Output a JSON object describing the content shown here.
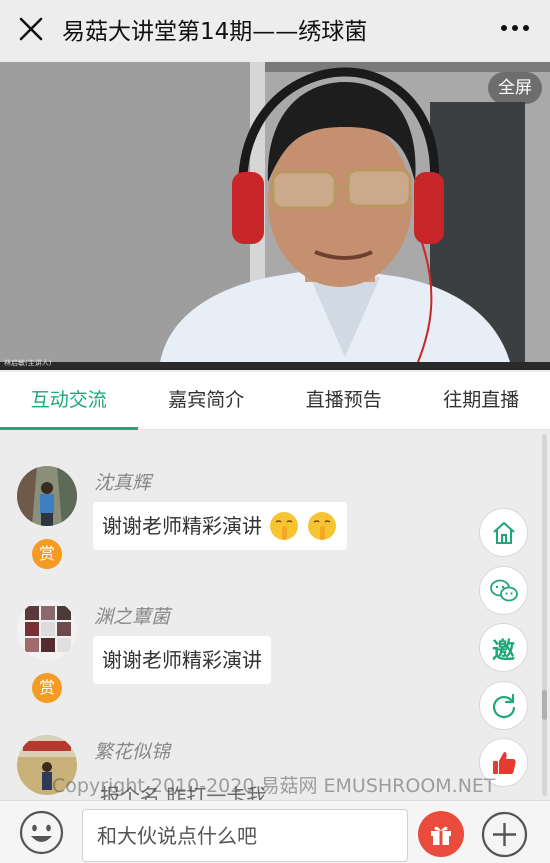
{
  "header": {
    "title": "易菇大讲堂第14期——绣球菌",
    "close_icon": "close-icon",
    "more_icon": "more-horizontal-icon"
  },
  "video": {
    "fullscreen_label": "全屏",
    "speaker_tag": "林启敏(主讲人)"
  },
  "tabs": [
    {
      "label": "互动交流",
      "active": true
    },
    {
      "label": "嘉宾简介",
      "active": false
    },
    {
      "label": "直播预告",
      "active": false
    },
    {
      "label": "往期直播",
      "active": false
    }
  ],
  "chat": {
    "messages": [
      {
        "user": "沈真辉",
        "text": "谢谢老师精彩演讲",
        "emojis": [
          "shush-emoji",
          "shush-emoji"
        ],
        "badge": "赏"
      },
      {
        "user": "渊之蕈菌",
        "text": "谢谢老师精彩演讲",
        "badge": "赏"
      },
      {
        "user": "繁花似锦",
        "text": "报个名 昨打一卡我"
      }
    ]
  },
  "floating_actions": {
    "home_icon": "home-icon",
    "wechat_icon": "wechat-icon",
    "invite_label": "邀",
    "refresh_icon": "refresh-icon",
    "like_icon": "thumbs-up-icon"
  },
  "watermark": "Copyright 2010-2020 易菇网 EMUSHROOM.NET",
  "bottom": {
    "input_placeholder": "和大伙说点什么吧",
    "emoji_icon": "smiley-icon",
    "gift_icon": "gift-icon",
    "plus_icon": "plus-icon"
  },
  "colors": {
    "accent": "#1fa67a",
    "badge": "#f59a23",
    "gift": "#e94b3c",
    "like": "#e53a2f"
  }
}
